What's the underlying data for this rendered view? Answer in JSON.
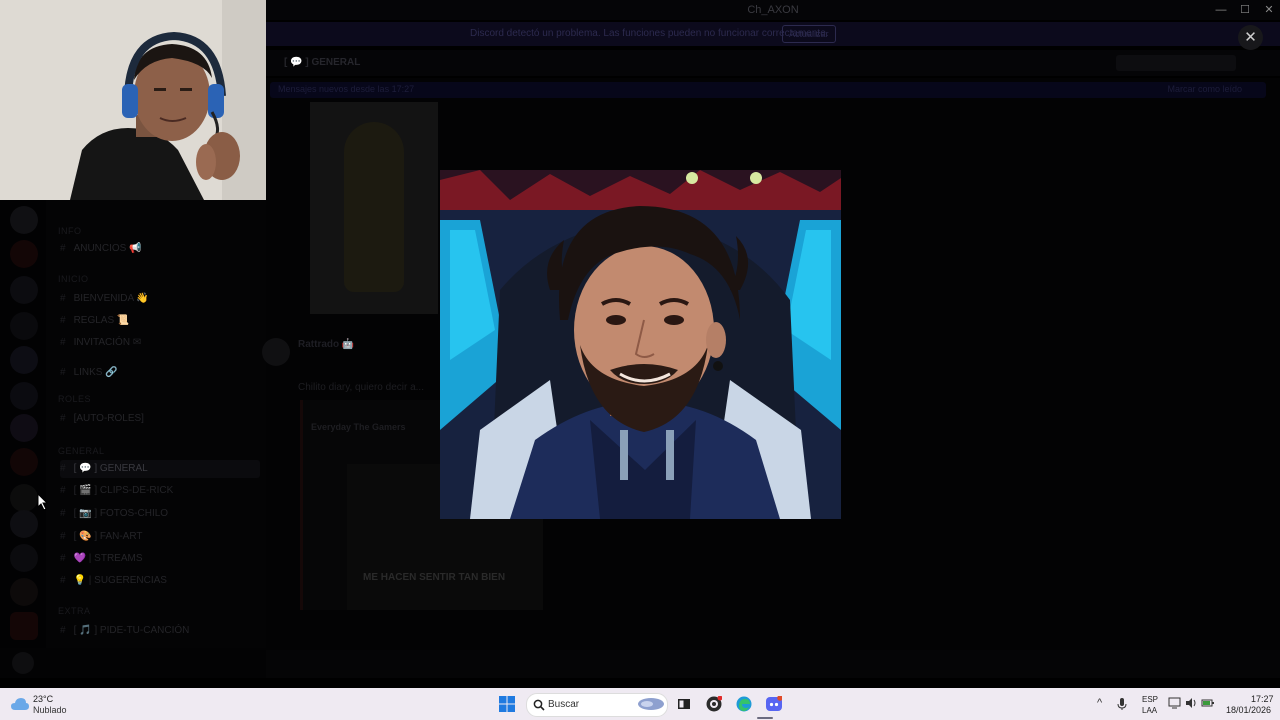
{
  "window": {
    "title": "Ch_AXON"
  },
  "banner": {
    "text": "Discord detectó un problema. Las funciones pueden no funcionar correctamente.",
    "button_label": "Actualizar"
  },
  "topbar": {
    "channel_title": "[ 💬 ] GENERAL"
  },
  "new_messages_bar": {
    "left": "Mensajes nuevos desde las 17:27",
    "right": "Marcar como leído"
  },
  "sidebar": {
    "categories": [
      "INFO",
      "INICIO",
      "ROLES",
      "GENERAL",
      "EXTRA"
    ],
    "channels": [
      {
        "label": "ANUNCIOS 📢"
      },
      {
        "label": "BIENVENIDA 👋"
      },
      {
        "label": "REGLAS 📜"
      },
      {
        "label": "INVITACIÓN ✉"
      },
      {
        "label": "LINKS 🔗"
      },
      {
        "label": "[AUTO-ROLES]"
      },
      {
        "label": "[ 💬 ] GENERAL",
        "selected": true
      },
      {
        "label": "[ 🎬 ] CLIPS-DE-RICK"
      },
      {
        "label": "[ 📷 ] FOTOS-CHILO"
      },
      {
        "label": "[ 🎨 ] FAN-ART"
      },
      {
        "label": "💜 | STREAMS"
      },
      {
        "label": "💡 | SUGERENCIAS"
      },
      {
        "label": "[ 🎵 ] PIDE-TU-CANCIÓN"
      }
    ]
  },
  "message": {
    "author": "Rattrado 🤖",
    "text": "Chilito diary, quiero decir a...",
    "embed_title": "Everyday The Gamers",
    "video_caption": "ME HACEN SENTIR TAN BIEN"
  },
  "overlay": {
    "close_label": "✕",
    "image_alt": "Retrato ampliado"
  },
  "taskbar": {
    "weather_temp": "23°C",
    "weather_cond": "Nublado",
    "search_placeholder": "Buscar",
    "lang_top": "ESP",
    "lang_bottom": "LAA",
    "time": "17:27",
    "date": "18/01/2026"
  }
}
